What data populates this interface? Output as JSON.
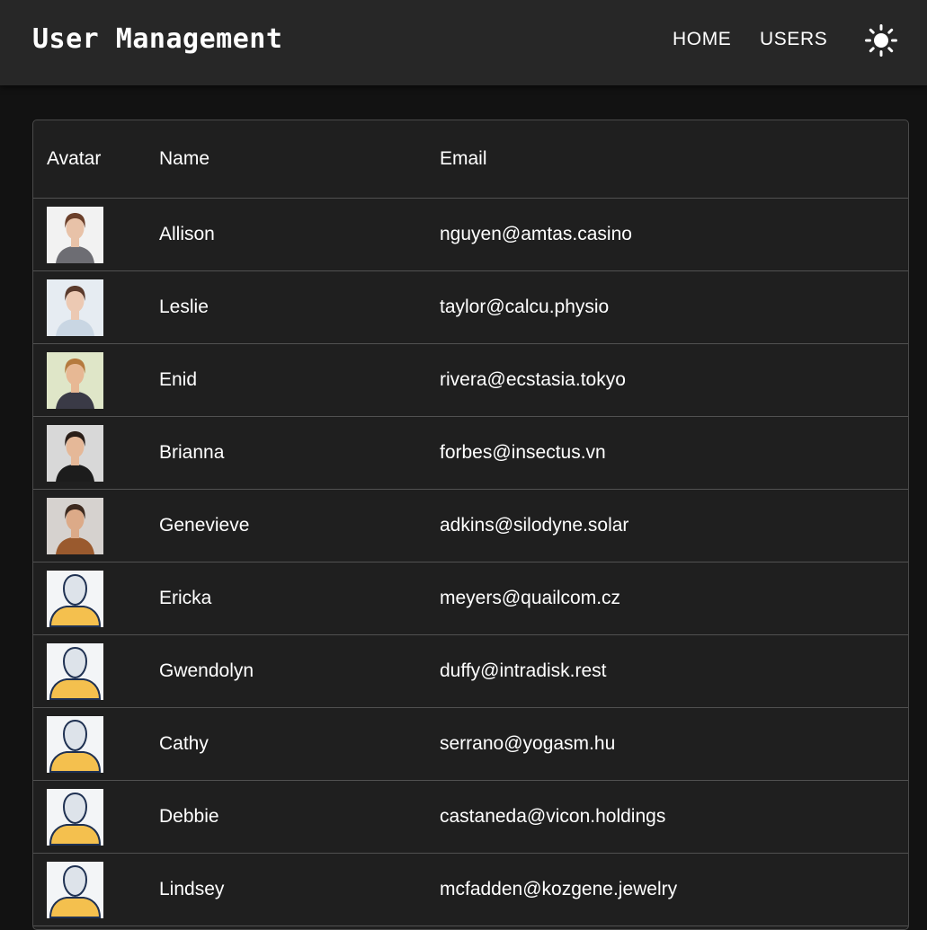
{
  "header": {
    "title": "User Management",
    "nav": [
      {
        "label": "HOME"
      },
      {
        "label": "USERS"
      }
    ],
    "theme_icon": "sun-icon"
  },
  "table": {
    "columns": [
      "Avatar",
      "Name",
      "Email"
    ],
    "rows": [
      {
        "name": "Allison",
        "email": "nguyen@amtas.casino",
        "avatar": "photo",
        "hair": "#6b3f2a",
        "skin": "#e8c2a8",
        "bg": "#f2f2f2",
        "shirt": "#6d6d73"
      },
      {
        "name": "Leslie",
        "email": "taylor@calcu.physio",
        "avatar": "photo",
        "hair": "#5a3a2c",
        "skin": "#ecc9b3",
        "bg": "#e6ecf2",
        "shirt": "#c9d6e3"
      },
      {
        "name": "Enid",
        "email": "rivera@ecstasia.tokyo",
        "avatar": "photo",
        "hair": "#b57a3e",
        "skin": "#e7b894",
        "bg": "#dfe6c8",
        "shirt": "#3a3a46"
      },
      {
        "name": "Brianna",
        "email": "forbes@insectus.vn",
        "avatar": "photo",
        "hair": "#2a1e18",
        "skin": "#e5b898",
        "bg": "#d8d8d8",
        "shirt": "#1c1c1c"
      },
      {
        "name": "Genevieve",
        "email": "adkins@silodyne.solar",
        "avatar": "photo",
        "hair": "#3d2a1f",
        "skin": "#dcaa88",
        "bg": "#d6d2cf",
        "shirt": "#9a5a2e"
      },
      {
        "name": "Ericka",
        "email": "meyers@quailcom.cz",
        "avatar": "placeholder"
      },
      {
        "name": "Gwendolyn",
        "email": "duffy@intradisk.rest",
        "avatar": "placeholder"
      },
      {
        "name": "Cathy",
        "email": "serrano@yogasm.hu",
        "avatar": "placeholder"
      },
      {
        "name": "Debbie",
        "email": "castaneda@vicon.holdings",
        "avatar": "placeholder"
      },
      {
        "name": "Lindsey",
        "email": "mcfadden@kozgene.jewelry",
        "avatar": "placeholder"
      }
    ]
  },
  "colors": {
    "page_bg": "#121212",
    "appbar_bg": "#272727",
    "card_bg": "#1f1f1f",
    "divider": "#515151",
    "placeholder_body": "#f4c04e",
    "placeholder_head": "#dde3ea",
    "placeholder_outline": "#1f3152"
  }
}
